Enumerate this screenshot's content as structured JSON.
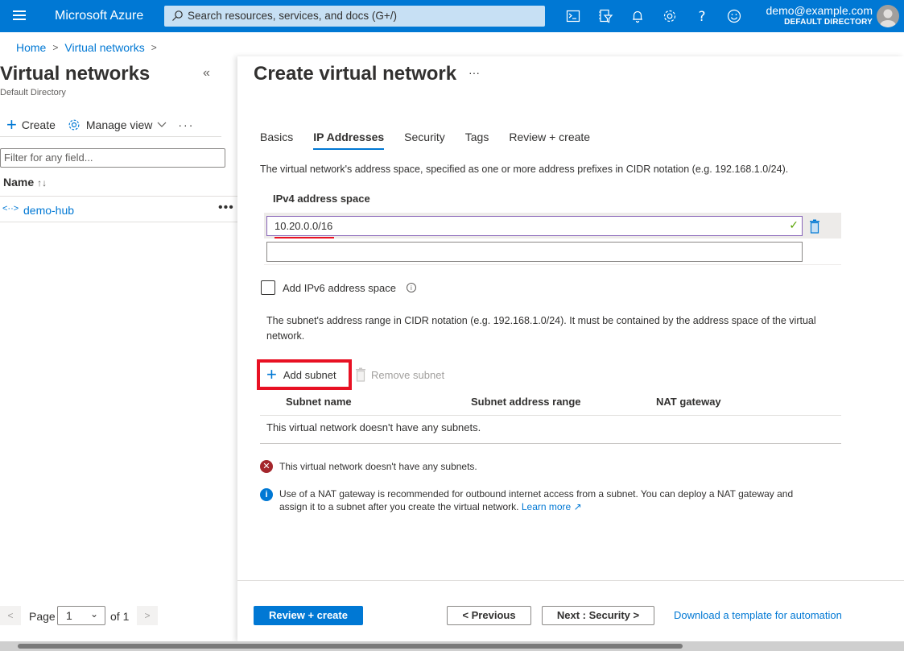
{
  "topbar": {
    "brand": "Microsoft Azure",
    "search_placeholder": "Search resources, services, and docs (G+/)",
    "icons": [
      "cloud-shell-icon",
      "directory-filter-icon",
      "notifications-icon",
      "settings-icon",
      "help-icon",
      "feedback-icon"
    ],
    "account_email": "demo@example.com",
    "account_directory": "DEFAULT DIRECTORY"
  },
  "breadcrumb": [
    {
      "label": "Home"
    },
    {
      "label": "Virtual networks"
    }
  ],
  "left_panel": {
    "title": "Virtual networks",
    "subtitle": "Default Directory",
    "toolbar": {
      "create_label": "Create",
      "manage_view_label": "Manage view",
      "more_label": "···"
    },
    "filter_placeholder": "Filter for any field...",
    "column_header": "Name",
    "sort_glyph": "↑↓",
    "items": [
      {
        "name": "demo-hub",
        "more": "•••"
      }
    ],
    "pager": {
      "prev": "<",
      "page_label": "Page",
      "current_page": "1",
      "of_label": "of 1",
      "next": ">"
    }
  },
  "blade": {
    "title": "Create virtual network",
    "more": "···",
    "tabs": [
      {
        "label": "Basics",
        "active": false
      },
      {
        "label": "IP Addresses",
        "active": true
      },
      {
        "label": "Security",
        "active": false
      },
      {
        "label": "Tags",
        "active": false
      },
      {
        "label": "Review + create",
        "active": false
      }
    ],
    "address_space_description": "The virtual network's address space, specified as one or more address prefixes in CIDR notation (e.g. 192.168.1.0/24).",
    "ipv4_label": "IPv4 address space",
    "ipv4_values": [
      "10.20.0.0/16",
      ""
    ],
    "ipv6_checkbox_label": "Add IPv6 address space",
    "ipv6_checked": false,
    "subnet_description": "The subnet's address range in CIDR notation (e.g. 192.168.1.0/24). It must be contained by the address space of the virtual network.",
    "add_subnet_label": "Add subnet",
    "remove_subnet_label": "Remove subnet",
    "subnet_columns": [
      "Subnet name",
      "Subnet address range",
      "NAT gateway"
    ],
    "no_subnets_text": "This virtual network doesn't have any subnets.",
    "error_message": "This virtual network doesn't have any subnets.",
    "info_message": "Use of a NAT gateway is recommended for outbound internet access from a subnet. You can deploy a NAT gateway and assign it to a subnet after you create the virtual network.",
    "learn_more_label": "Learn more",
    "footer": {
      "review_create": "Review + create",
      "previous": "< Previous",
      "next": "Next : Security >",
      "download_template": "Download a template for automation"
    }
  },
  "colors": {
    "accent": "#0078d4",
    "error": "#a4262c",
    "highlight_box": "#e81123",
    "input_focus": "#8764b8",
    "valid_check": "#57a300"
  }
}
